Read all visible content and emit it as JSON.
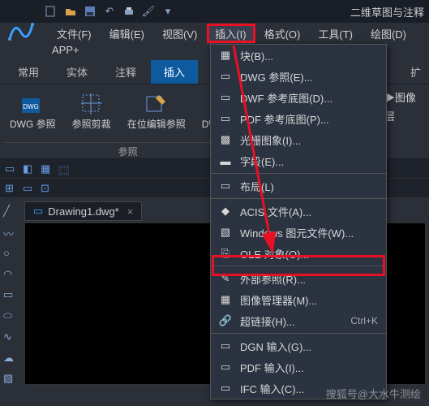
{
  "mode_label": "二维草图与注释",
  "menubar": {
    "file": "文件(F)",
    "edit": "编辑(E)",
    "view": "视图(V)",
    "insert": "插入(I)",
    "format": "格式(O)",
    "tools": "工具(T)",
    "draw": "绘图(D)"
  },
  "appplus": "APP+",
  "ribbon_tabs": {
    "common": "常用",
    "entity": "实体",
    "annot": "注释",
    "insert": "插入",
    "expand": "扩"
  },
  "ribbon": {
    "dwg_ref": "DWG\n参照",
    "clip": "参照剪裁",
    "edit_inplace": "在位编辑参照",
    "dwf_ref": "DWF\n考底",
    "panel_title": "参照"
  },
  "side": {
    "image": "▶图像",
    "layer": "层"
  },
  "doc_tab": "Drawing1.dwg*",
  "dropdown": [
    {
      "icon": "block",
      "label": "块(B)..."
    },
    {
      "icon": "dwg",
      "label": "DWG 参照(E)..."
    },
    {
      "icon": "dwf",
      "label": "DWF 参考底图(D)..."
    },
    {
      "icon": "pdf",
      "label": "PDF 参考底图(P)..."
    },
    {
      "icon": "raster",
      "label": "光栅图象(I)..."
    },
    {
      "icon": "field",
      "label": "字段(E)..."
    },
    {
      "sep": true
    },
    {
      "icon": "layout",
      "label": "布局(L)"
    },
    {
      "sep": true
    },
    {
      "icon": "acis",
      "label": "ACIS 文件(A)..."
    },
    {
      "icon": "wmf",
      "label": "Windows 图元文件(W)..."
    },
    {
      "icon": "ole",
      "label": "OLE 对象(O)...",
      "highlight": true
    },
    {
      "sep": true
    },
    {
      "icon": "xref",
      "label": "外部参照(R)..."
    },
    {
      "icon": "imgmgr",
      "label": "图像管理器(M)..."
    },
    {
      "icon": "link",
      "label": "超链接(H)...",
      "shortcut": "Ctrl+K"
    },
    {
      "sep": true
    },
    {
      "icon": "dgn",
      "label": "DGN 输入(G)..."
    },
    {
      "icon": "pdfin",
      "label": "PDF 输入(I)..."
    },
    {
      "icon": "ifc",
      "label": "IFC 输入(C)..."
    }
  ],
  "watermark": "搜狐号@大水牛测绘"
}
